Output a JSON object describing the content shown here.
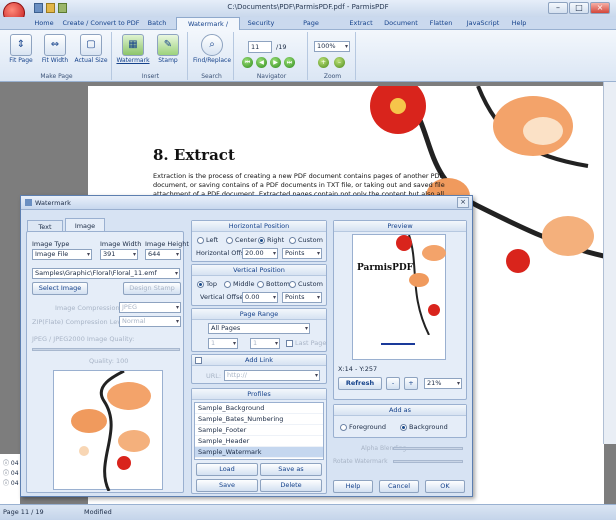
{
  "window": {
    "title": "C:\\Documents\\PDF\\ParmisPDF.pdf - ParmisPDF"
  },
  "tabs": [
    "Home",
    "Create / Convert to PDF",
    "Batch",
    "Watermark / Stamp",
    "Security",
    "Page Manipulation",
    "Extract",
    "Document",
    "Flatten",
    "JavaScript",
    "Help"
  ],
  "ribbon": {
    "make_page": {
      "label": "Make Page",
      "fit_page": "Fit Page",
      "fit_width": "Fit Width",
      "actual_size": "Actual Size"
    },
    "insert": {
      "label": "Insert",
      "watermark": "Watermark",
      "stamp": "Stamp"
    },
    "search": {
      "label": "Search",
      "find_replace": "Find/Replace"
    },
    "navigator": {
      "label": "Navigator",
      "page": "11",
      "total": "/19"
    },
    "zoom": {
      "label": "Zoom",
      "value": "100%"
    }
  },
  "document": {
    "heading": "8. Extract",
    "body": "Extraction is the process of creating a new PDF document contains pages of another PDF document, or saving contains of a PDF documents in TXT file, or taking out and saved file attachment of a PDF document. Extracted pages contain not only the content but also all form"
  },
  "log": [
    "04",
    "04",
    "04"
  ],
  "status": {
    "page": "Page 11 / 19",
    "modified": "Modified"
  },
  "dialog": {
    "title": "Watermark",
    "tabs": [
      "Text",
      "Image"
    ],
    "image": {
      "type_label": "Image Type",
      "type_value": "Image File",
      "width_label": "Image Width",
      "width_value": "391",
      "height_label": "Image Height",
      "height_value": "644",
      "path": "Samples\\Graphic\\Floral\\Floral_11.emf",
      "select_image": "Select Image",
      "design_stamp": "Design Stamp",
      "compression_label": "Image Compression",
      "compression_value": "JPEG",
      "zip_label": "ZIP(Flate) Compression Level",
      "zip_value": "Normal",
      "jpeg_label": "JPEG / JPEG2000 Image Quality:",
      "quality_label": "Quality: 100"
    },
    "horizontal": {
      "title": "Horizontal Position",
      "options": [
        "Left",
        "Center",
        "Right",
        "Custom"
      ],
      "selected": 2,
      "offset_label": "Horizontal Offset:",
      "offset_value": "20.00",
      "unit": "Points"
    },
    "vertical": {
      "title": "Vertical Position",
      "options": [
        "Top",
        "Middle",
        "Bottom",
        "Custom"
      ],
      "selected": 0,
      "offset_label": "Vertical Offset:",
      "offset_value": "0.00",
      "unit": "Points"
    },
    "page_range": {
      "title": "Page Range",
      "value": "All Pages",
      "from": "1",
      "to": "1",
      "last_page": "Last Page"
    },
    "add_link": {
      "title": "Add Link",
      "url_label": "URL:",
      "url_value": "http://"
    },
    "profiles": {
      "title": "Profiles",
      "items": [
        "Sample_Background",
        "Sample_Bates_Numbering",
        "Sample_Footer",
        "Sample_Header",
        "Sample_Watermark"
      ],
      "selected": 4,
      "load": "Load",
      "save_as": "Save as",
      "save": "Save",
      "delete": "Delete"
    },
    "preview": {
      "title": "Preview",
      "brand": "ParmisPDF",
      "coords": "X:14  -  Y:257",
      "refresh": "Refresh",
      "minus": "-",
      "plus": "+",
      "zoom": "21%"
    },
    "add_as": {
      "title": "Add as",
      "options": [
        "Foreground",
        "Background"
      ],
      "selected": 1
    },
    "opacity_label": "Alpha Blending",
    "rotation_label": "Rotate Watermark",
    "help": "Help",
    "cancel": "Cancel",
    "ok": "OK"
  }
}
